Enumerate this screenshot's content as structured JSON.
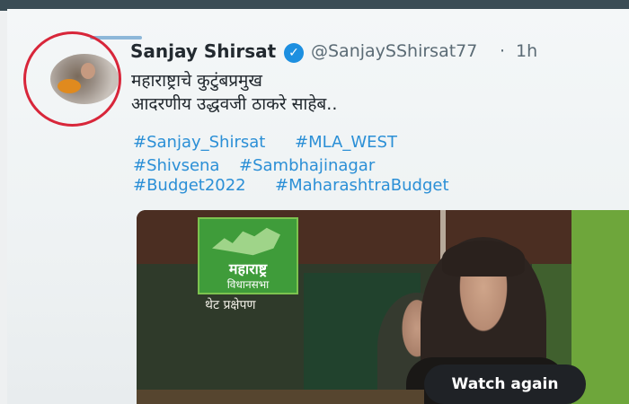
{
  "tweet": {
    "name": "Sanjay Shirsat",
    "handle": "@SanjaySShirsat77",
    "separator": "·",
    "time": "1h",
    "lines": [
      "महाराष्ट्राचे कुटुंबप्रमुख",
      "आदरणीय उद्धवजी ठाकरे साहेब.."
    ],
    "hashtags": [
      "#Sanjay_Shirsat",
      "#MLA_WEST",
      "#Shivsena",
      "#Sambhajinagar",
      "#Budget2022",
      "#MaharashtraBudget"
    ]
  },
  "media": {
    "logo_line1": "महाराष्ट्र",
    "logo_line2": "विधानसभा",
    "live_text": "थेट प्रक्षेपण",
    "watch_again": "Watch again"
  },
  "colors": {
    "accent": "#1d8fe0",
    "hashtag": "#2b8fd6",
    "highlight_circle": "#d8263a"
  },
  "icons": {
    "verified": "verified-badge-icon"
  }
}
